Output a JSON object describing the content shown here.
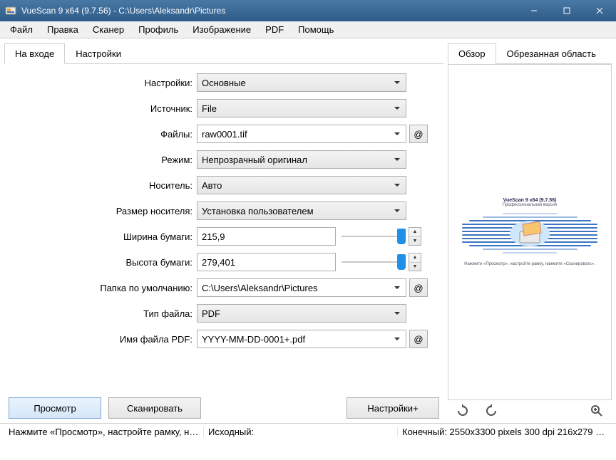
{
  "window": {
    "title": "VueScan 9 x64 (9.7.56) - C:\\Users\\Aleksandr\\Pictures"
  },
  "menu": [
    "Файл",
    "Правка",
    "Сканер",
    "Профиль",
    "Изображение",
    "PDF",
    "Помощь"
  ],
  "left_tabs": [
    "На входе",
    "Настройки"
  ],
  "right_tabs": [
    "Обзор",
    "Обрезанная область"
  ],
  "form": {
    "settings": {
      "label": "Настройки:",
      "value": "Основные"
    },
    "source": {
      "label": "Источник:",
      "value": "File"
    },
    "files": {
      "label": "Файлы:",
      "value": "raw0001.tif"
    },
    "mode": {
      "label": "Режим:",
      "value": "Непрозрачный оригинал"
    },
    "media": {
      "label": "Носитель:",
      "value": "Авто"
    },
    "media_size": {
      "label": "Размер носителя:",
      "value": "Установка пользователем"
    },
    "paper_width": {
      "label": "Ширина бумаги:",
      "value": "215,9"
    },
    "paper_height": {
      "label": "Высота бумаги:",
      "value": "279,401"
    },
    "default_folder": {
      "label": "Папка по умолчанию:",
      "value": "C:\\Users\\Aleksandr\\Pictures"
    },
    "file_type": {
      "label": "Тип файла:",
      "value": "PDF"
    },
    "pdf_name": {
      "label": "Имя файла PDF:",
      "value": "YYYY-MM-DD-0001+.pdf"
    },
    "at": "@"
  },
  "buttons": {
    "preview": "Просмотр",
    "scan": "Сканировать",
    "settings_plus": "Настройки+"
  },
  "preview": {
    "title": "VueScan 9 x64 (9.7.56)",
    "subtitle": "Профессиональная версия",
    "hint": "Нажмите «Просмотр», настройте рамку, нажмите «Сканировать»."
  },
  "status": {
    "hint": "Нажмите «Просмотр», настройте рамку, нажм...",
    "source": "Исходный:",
    "dest": "Конечный: 2550x3300 pixels 300 dpi 216x279 mm ..."
  }
}
